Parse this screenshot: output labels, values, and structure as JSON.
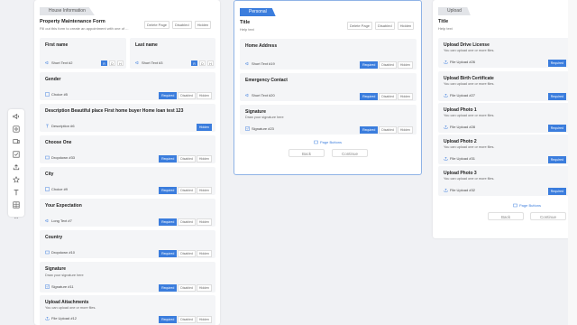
{
  "toolbar": {
    "icons": [
      "audio-icon",
      "image-icon",
      "video-icon",
      "checkbox-icon",
      "upload-icon",
      "star-icon",
      "text-icon",
      "table-icon"
    ],
    "more": "..."
  },
  "pages": [
    {
      "tab": "House Information",
      "title": "Property Maintenance Form",
      "desc": "Fill out this form to create an appointment with one of ...",
      "controls": [
        "Delete Page",
        "Disabled",
        "Hidden"
      ],
      "questions": [
        {
          "title": "First name",
          "type": "Short Text #2"
        },
        {
          "title": "Last name",
          "type": "Short Text #3"
        },
        {
          "title": "Gender",
          "type": "Choice #5",
          "r": "Required",
          "d": "Disabled",
          "h": "Hidden"
        },
        {
          "title": "Description Beautiful place First home buyer Home loan test 123",
          "type": "Description #6",
          "h": "Hidden"
        },
        {
          "title": "Choose One",
          "type": "Dropdown #33",
          "r": "Required",
          "d": "Disabled",
          "h": "Hidden"
        },
        {
          "title": "City",
          "type": "Choice #9",
          "r": "Required",
          "d": "Disabled",
          "h": "Hidden"
        },
        {
          "title": "Your Expectation",
          "type": "Long Text #7",
          "r": "Required",
          "d": "Disabled",
          "h": "Hidden"
        },
        {
          "title": "Country",
          "type": "Dropdown #10",
          "r": "Required",
          "d": "Disabled",
          "h": "Hidden"
        },
        {
          "title": "Signature",
          "desc": "Draw your signature here",
          "type": "Signature #11",
          "r": "Required",
          "d": "Disabled",
          "h": "Hidden"
        },
        {
          "title": "Upload Attachments",
          "desc": "You can upload one or more files.",
          "type": "File Upload #12",
          "r": "Required",
          "d": "Disabled",
          "h": "Hidden"
        }
      ]
    },
    {
      "tab": "Personal",
      "title": "Title",
      "desc": "Help text",
      "controls": [
        "Delete Page",
        "Disabled",
        "Hidden"
      ],
      "questions": [
        {
          "title": "Home Address",
          "type": "Short Text #19",
          "r": "Required",
          "d": "Disabled",
          "h": "Hidden"
        },
        {
          "title": "Emergency Contact",
          "type": "Short Text #20",
          "r": "Required",
          "d": "Disabled",
          "h": "Hidden"
        },
        {
          "title": "Signature",
          "desc": "Draw your signature here",
          "type": "Signature #23",
          "r": "Required",
          "d": "Disabled",
          "h": "Hidden"
        }
      ],
      "page_buttons": "Page Buttons",
      "back": "Back",
      "continue": "Continue"
    },
    {
      "tab": "Upload",
      "title": "Title",
      "desc": "Help text",
      "questions": [
        {
          "title": "Upload Drive License",
          "desc": "You can upload one or more files.",
          "type": "File Upload #26",
          "r": "Required"
        },
        {
          "title": "Upload Birth Certificate",
          "desc": "You can upload one or more files.",
          "type": "File Upload #27",
          "r": "Required"
        },
        {
          "title": "Upload Photo 1",
          "desc": "You can upload one or more files.",
          "type": "File Upload #28",
          "r": "Required"
        },
        {
          "title": "Upload Photo 2",
          "desc": "You can upload one or more files.",
          "type": "File Upload #31",
          "r": "Required"
        },
        {
          "title": "Upload Photo 3",
          "desc": "You can upload one or more files.",
          "type": "File Upload #32",
          "r": "Required"
        }
      ],
      "page_buttons": "Page Buttons",
      "back": "Back",
      "continue": "Continue"
    }
  ],
  "colors": {
    "accent": "#3b7ddd",
    "card": "#f4f5f7",
    "background": "#f0f1f4"
  }
}
